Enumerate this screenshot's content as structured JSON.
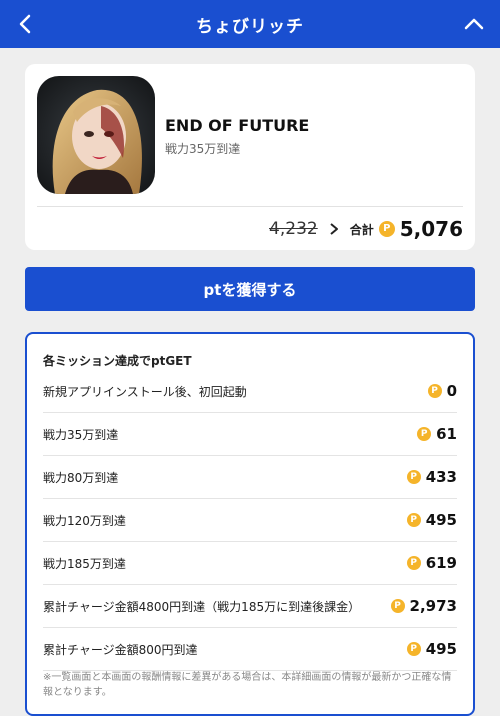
{
  "header": {
    "title": "ちょびリッチ"
  },
  "app": {
    "name": "END OF FUTURE",
    "subtitle": "戦力35万到達",
    "old_points": "4,232",
    "total_label": "合計",
    "total_points": "5,076"
  },
  "cta": {
    "label": "ptを獲得する"
  },
  "missions": {
    "heading": "各ミッション達成でptGET",
    "coin_symbol": "P",
    "items": [
      {
        "label": "新規アプリインストール後、初回起動",
        "points": "0"
      },
      {
        "label": "戦力35万到達",
        "points": "61"
      },
      {
        "label": "戦力80万到達",
        "points": "433"
      },
      {
        "label": "戦力120万到達",
        "points": "495"
      },
      {
        "label": "戦力185万到達",
        "points": "619"
      },
      {
        "label": "累計チャージ金額4800円到達（戦力185万に到達後課金）",
        "points": "2,973"
      },
      {
        "label": "累計チャージ金額800円到達",
        "points": "495"
      }
    ],
    "note": "※一覧画面と本画面の報酬情報に差異がある場合は、本詳細画面の情報が最新かつ正確な情報となります。"
  },
  "icons": [
    "chevron-left-icon",
    "chevron-up-icon",
    "chevron-right-icon",
    "point-coin-icon"
  ],
  "colors": {
    "brand": "#1a4fd0",
    "coin": "#f5b42a",
    "background": "#eeeeee"
  }
}
